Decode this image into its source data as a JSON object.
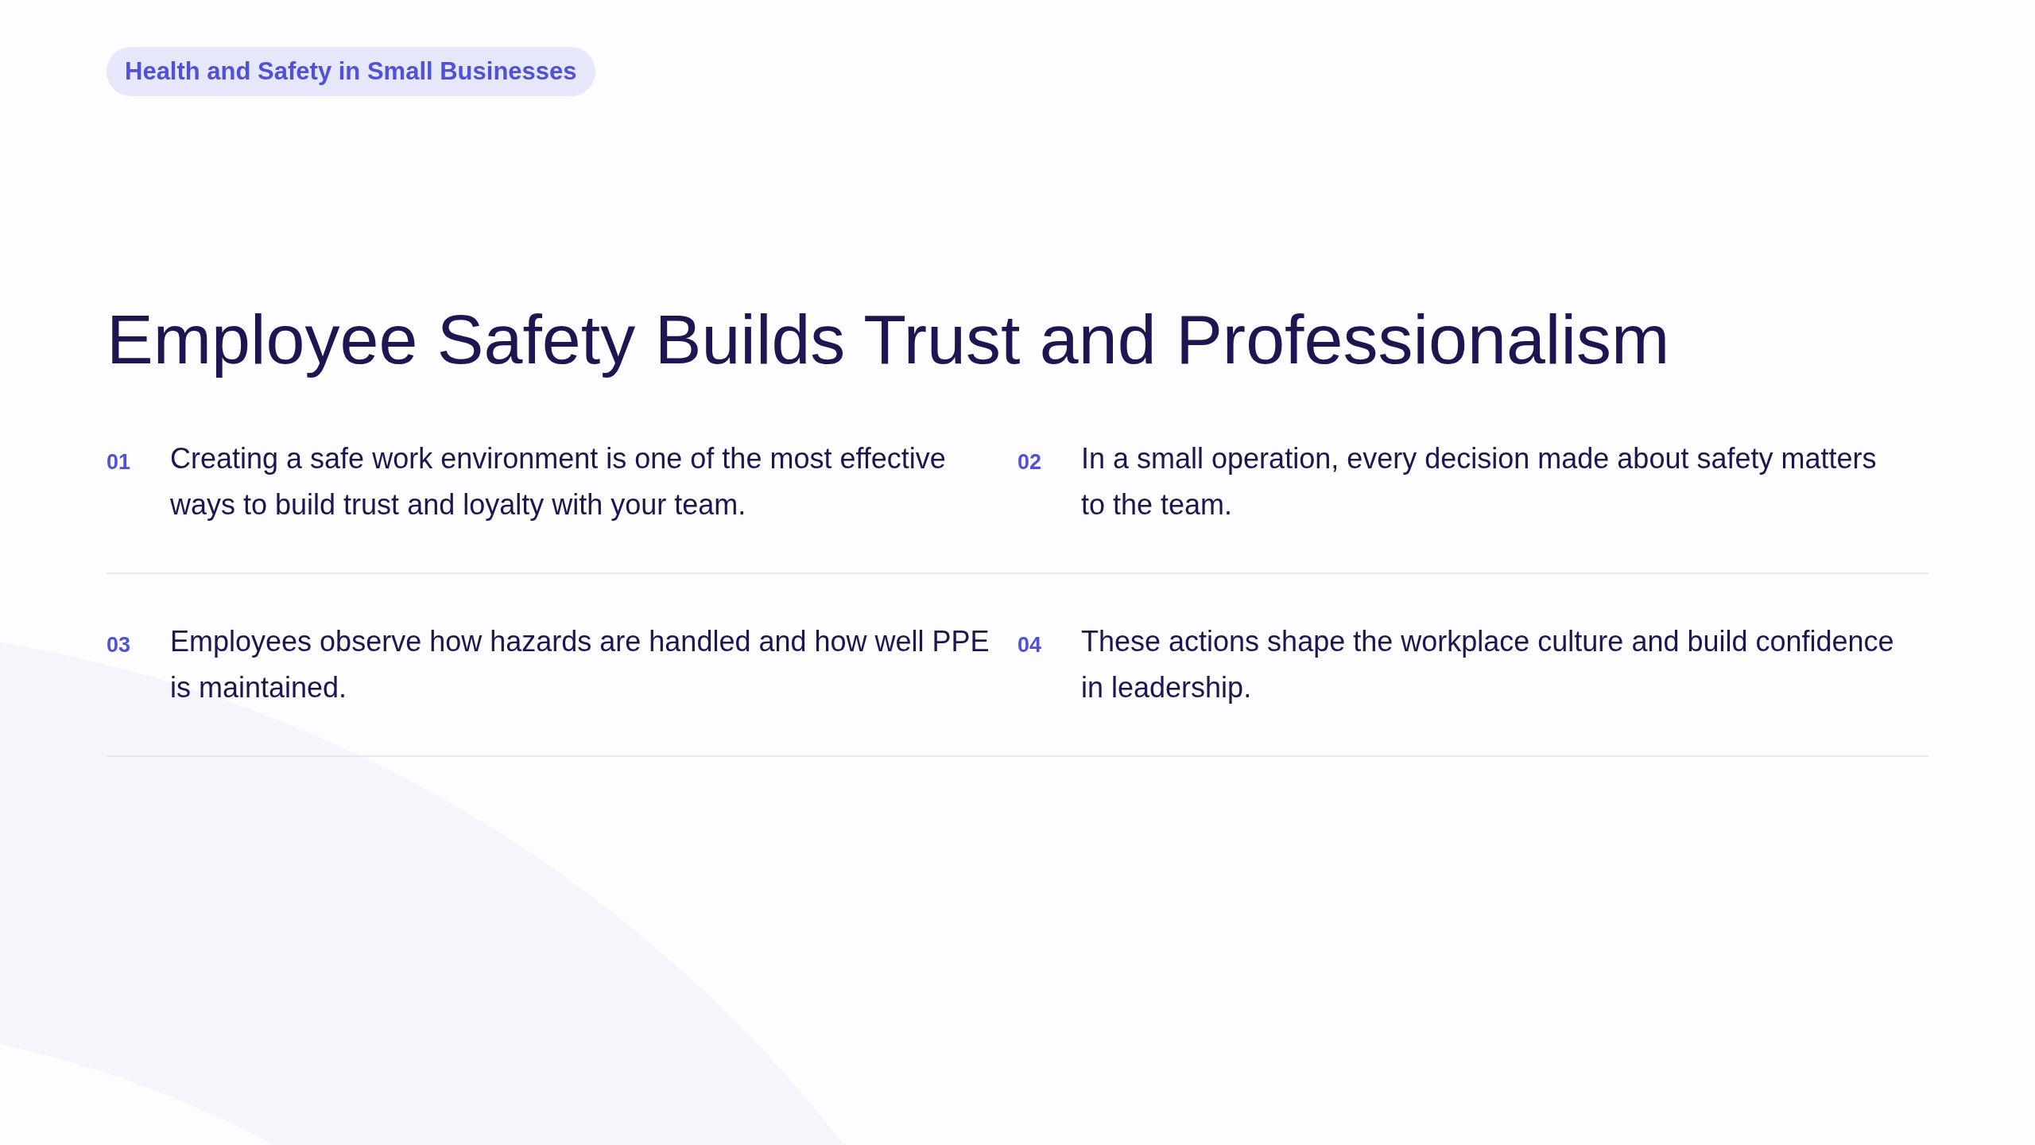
{
  "badge": "Health and Safety in Small Businesses",
  "title": "Employee Safety Builds Trust and Professionalism",
  "rows": [
    [
      {
        "number": "01",
        "text": "Creating a safe work environment is one of the most effective ways to build trust and loyalty with your team."
      },
      {
        "number": "02",
        "text": "In a small operation, every decision made about safety matters to the team."
      }
    ],
    [
      {
        "number": "03",
        "text": "Employees observe how hazards are handled and how well PPE is maintained."
      },
      {
        "number": "04",
        "text": "These actions shape the workplace culture and build confidence in leadership."
      }
    ]
  ]
}
